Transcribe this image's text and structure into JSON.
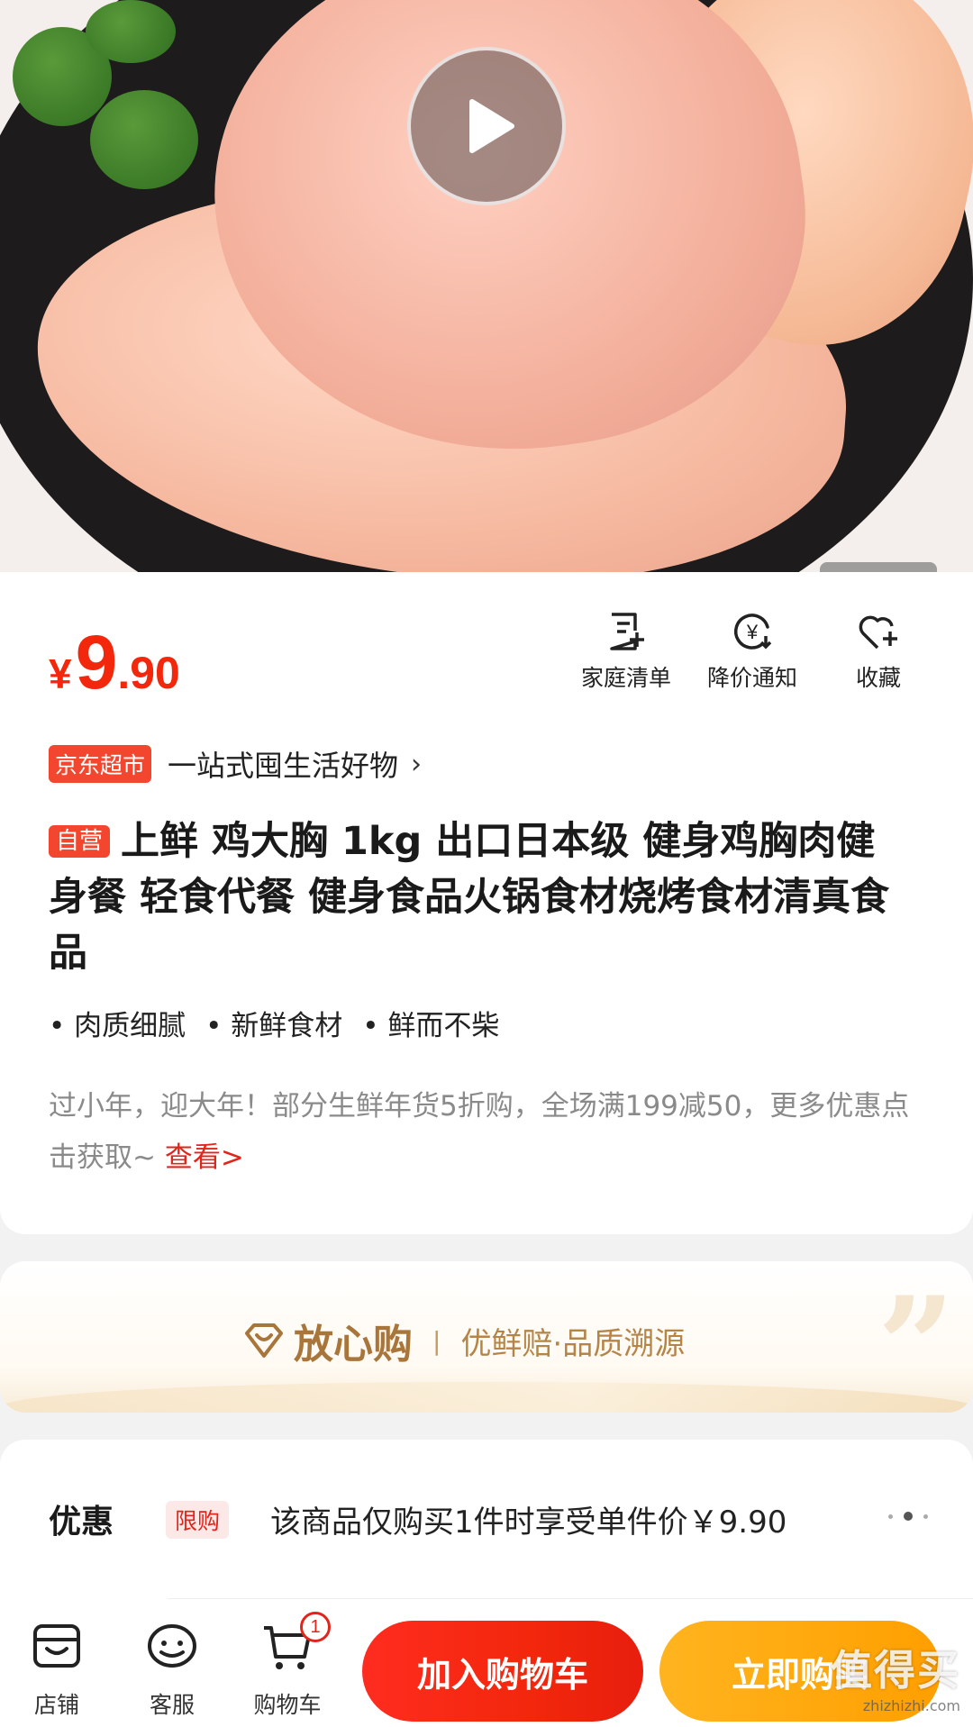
{
  "hero": {
    "play_icon": "play-icon"
  },
  "price": {
    "currency": "¥",
    "integer": "9",
    "decimal": ".90"
  },
  "actions": [
    {
      "label": "家庭清单",
      "icon": "list-add-icon"
    },
    {
      "label": "降价通知",
      "icon": "price-drop-icon"
    },
    {
      "label": "收藏",
      "icon": "heart-add-icon"
    }
  ],
  "store": {
    "tag": "京东超市",
    "text": "一站式囤生活好物",
    "chevron": "›"
  },
  "product": {
    "self_tag": "自营",
    "title": "上鲜 鸡大胸 1kg 出口日本级 健身鸡胸肉健身餐 轻食代餐 健身食品火锅食材烧烤食材清真食品",
    "points": [
      "肉质细腻",
      "新鲜食材",
      "鲜而不柴"
    ]
  },
  "promo": {
    "text": "过小年，迎大年！部分生鲜年货5折购，全场满199减50，更多优惠点击获取~ ",
    "link": "查看>"
  },
  "guarantee": {
    "title": "放心购",
    "separator": "|",
    "subtitle": "优鲜赔·品质溯源",
    "quote_mark": "”"
  },
  "discount": {
    "label": "优惠",
    "tag": "限购",
    "text": "该商品仅购买1件时享受单件价￥9.90"
  },
  "bottom_nav": [
    {
      "label": "店铺",
      "icon": "store-icon"
    },
    {
      "label": "客服",
      "icon": "customer-service-icon"
    },
    {
      "label": "购物车",
      "icon": "cart-icon",
      "badge": "1"
    }
  ],
  "buttons": {
    "add_to_cart": "加入购物车",
    "buy_now": "立即购买"
  },
  "watermark": {
    "main": "值得买",
    "sub": "zhizhizhi.com"
  },
  "colors": {
    "accent_red": "#f2270c",
    "buy_orange": "#ff9f00",
    "gold": "#a8763a"
  }
}
